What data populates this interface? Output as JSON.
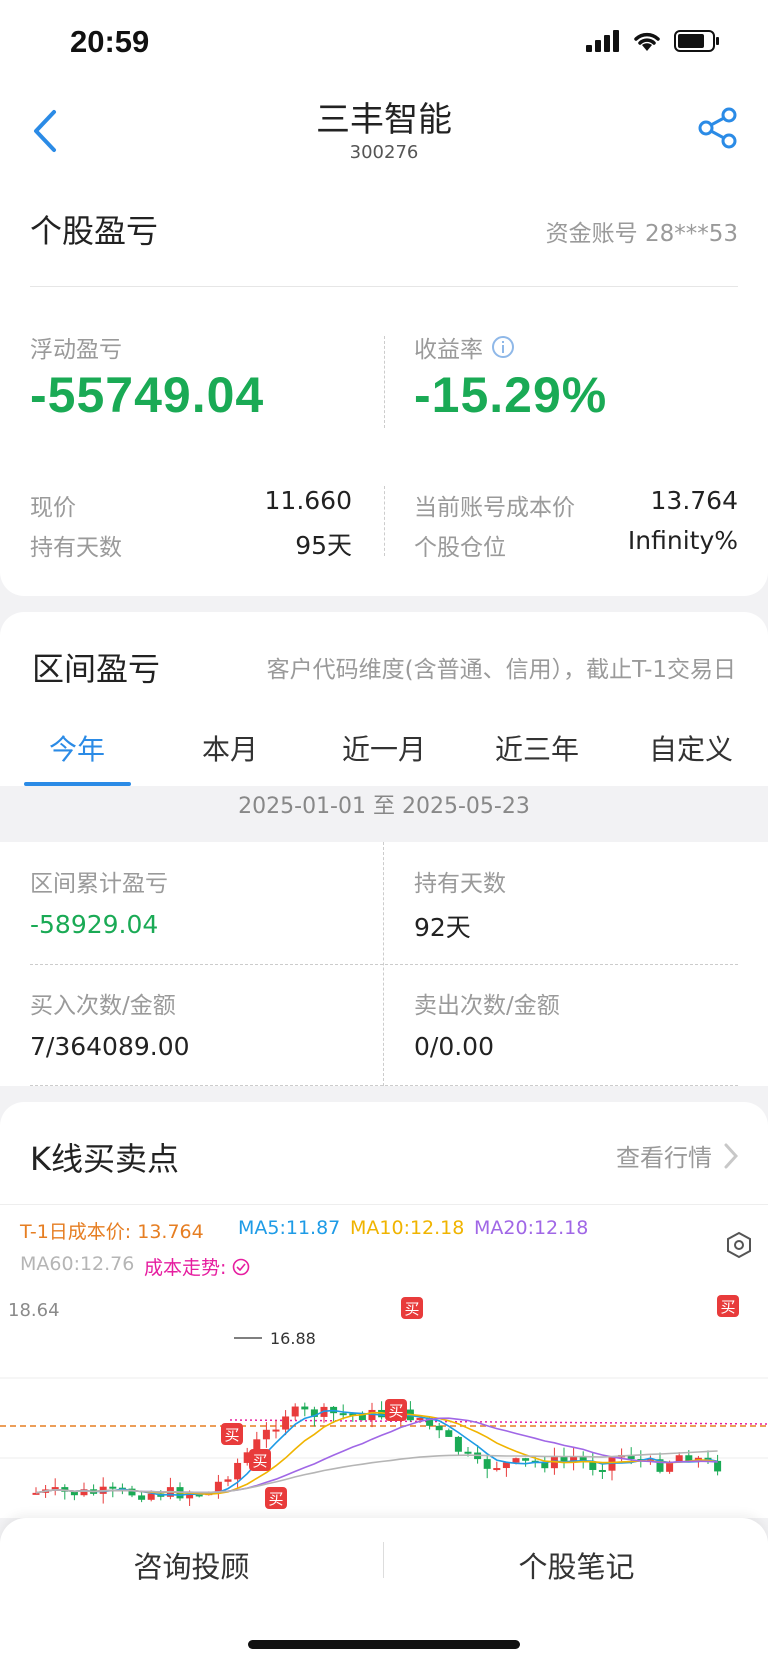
{
  "status_bar": {
    "time": "20:59"
  },
  "header": {
    "title": "三丰智能",
    "code": "300276"
  },
  "position": {
    "title": "个股盈亏",
    "account_label": "资金账号 28***53",
    "floating_pl_label": "浮动盈亏",
    "floating_pl": "-55749.04",
    "return_label": "收益率",
    "return_value": "-15.29%",
    "price_label": "现价",
    "price": "11.660",
    "days_label": "持有天数",
    "days": "95天",
    "cost_label": "当前账号成本价",
    "cost": "13.764",
    "weight_label": "个股仓位",
    "weight": "Infinity%"
  },
  "interval": {
    "title": "区间盈亏",
    "note": "客户代码维度(含普通、信用），截止T-1交易日",
    "tabs": [
      "今年",
      "本月",
      "近一月",
      "近三年",
      "自定义"
    ],
    "active_tab": 0,
    "date_range": "2025-01-01 至 2025-05-23",
    "cum_pl_label": "区间累计盈亏",
    "cum_pl": "-58929.04",
    "hold_days_label": "持有天数",
    "hold_days": "92天",
    "buy_label": "买入次数/金额",
    "buy_value": "7/364089.00",
    "sell_label": "卖出次数/金额",
    "sell_value": "0/0.00"
  },
  "kline": {
    "title": "K线买卖点",
    "view_label": "查看行情",
    "cost_legend": "T-1日成本价: 13.764",
    "ma5": "MA5:11.87",
    "ma10": "MA10:12.18",
    "ma20": "MA20:12.18",
    "ma60": "MA60:12.76",
    "cost_trend": "成本走势:",
    "y_max": "18.64",
    "peak_label": "16.88",
    "buy_marker": "买",
    "colors": {
      "cost": "#e67e22",
      "ma5": "#1e9be6",
      "ma10": "#f0b400",
      "ma20": "#a067e6",
      "ma60": "#b5b5b5",
      "trend": "#e61ea0",
      "up": "#e83b3b",
      "down": "#1aaa55"
    }
  },
  "bottom": {
    "consult": "咨询投顾",
    "notes": "个股笔记"
  }
}
